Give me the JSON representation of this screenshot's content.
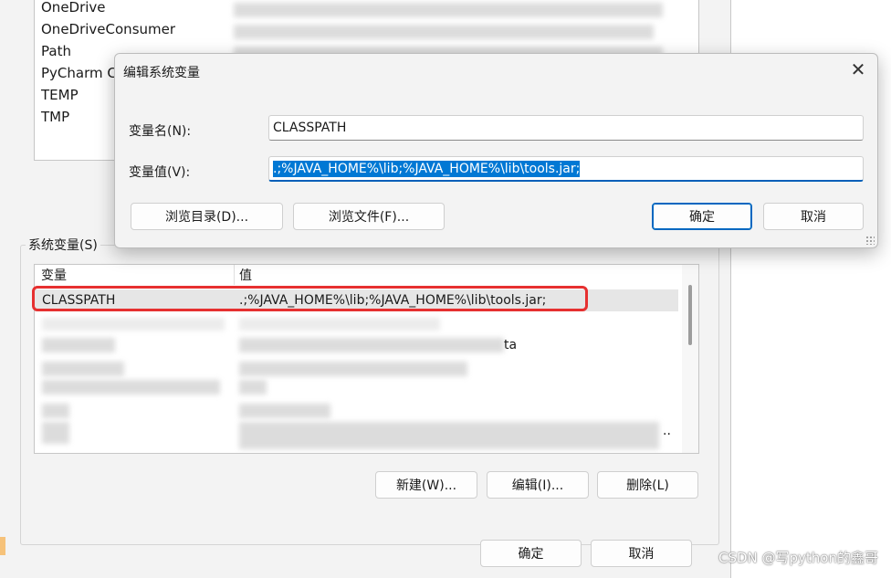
{
  "user_vars": {
    "items": [
      "OneDrive",
      "OneDriveConsumer",
      "Path",
      "PyCharm Co",
      "TEMP",
      "TMP"
    ]
  },
  "system_vars": {
    "group_label": "系统变量(S)",
    "columns": {
      "name": "变量",
      "value": "值"
    },
    "selected_row": {
      "name": "CLASSPATH",
      "value": ".;%JAVA_HOME%\\lib;%JAVA_HOME%\\lib\\tools.jar;"
    },
    "partial_text_1": "ta",
    "partial_text_2": "..",
    "buttons": {
      "new": "新建(W)...",
      "edit": "编辑(I)...",
      "delete": "删除(L)"
    }
  },
  "footer": {
    "ok": "确定",
    "cancel": "取消"
  },
  "edit_dialog": {
    "title": "编辑系统变量",
    "close_glyph": "✕",
    "name_label": "变量名(N):",
    "name_value": "CLASSPATH",
    "value_label": "变量值(V):",
    "value_value": ".;%JAVA_HOME%\\lib;%JAVA_HOME%\\lib\\tools.jar;",
    "browse_dir": "浏览目录(D)...",
    "browse_file": "浏览文件(F)...",
    "ok": "确定",
    "cancel": "取消"
  },
  "watermark": "CSDN @写python的鑫哥",
  "colors": {
    "accent": "#0078d4",
    "highlight_border": "#e63030"
  }
}
